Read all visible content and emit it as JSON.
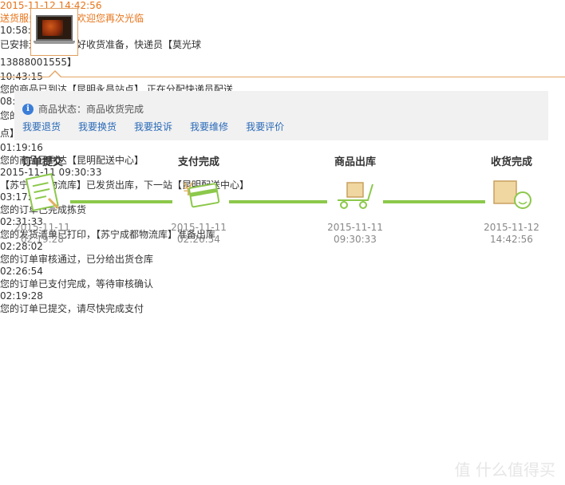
{
  "status": {
    "label": "商品状态：商品收货完成",
    "actions": [
      "我要退货",
      "我要换货",
      "我要投诉",
      "我要维修",
      "我要评价"
    ]
  },
  "steps": [
    {
      "title": "订单提交",
      "date": "2015-11-11",
      "time": "02:19:28"
    },
    {
      "title": "支付完成",
      "date": "2015-11-11",
      "time": "02:26:54"
    },
    {
      "title": "商品出库",
      "date": "2015-11-11",
      "time": "09:30:33"
    },
    {
      "title": "收货完成",
      "date": "2015-11-12",
      "time": "14:42:56"
    }
  ],
  "log": [
    {
      "time": "2015-11-12 14:42:56",
      "msg": "送货服务已完成，欢迎您再次光临",
      "highlight": true
    },
    {
      "time": "10:58:51",
      "msg": "已安排送货，请做好收货准备，快递员【莫光球 13888001555】"
    },
    {
      "time": "10:43:15",
      "msg": "您的商品已到达【昆明永昌站点】,正在分配快递员配送"
    },
    {
      "time": "08:57:43",
      "msg": "您的订单商品已出【昆明配送中心】，下一站【昆明永昌站点】"
    },
    {
      "time": "01:19:16",
      "msg": "您的商品已到达【昆明配送中心】"
    },
    {
      "time": "2015-11-11 09:30:33",
      "msg": "【苏宁成都物流库】已发货出库，下一站【昆明配送中心】"
    },
    {
      "time": "03:17:40",
      "msg": "您的订单已完成拣货"
    },
    {
      "time": "02:31:33",
      "msg": "您的发货清单已打印，【苏宁成都物流库】准备出库"
    },
    {
      "time": "02:28:02",
      "msg": "您的订单审核通过，已分给出货仓库"
    },
    {
      "time": "02:26:54",
      "msg": "您的订单已支付完成，等待审核确认"
    },
    {
      "time": "02:19:28",
      "msg": "您的订单已提交，请尽快完成支付"
    }
  ],
  "watermark": "值 什么值得买",
  "colors": {
    "accent": "#e8741a",
    "link": "#2a6ab8",
    "progress": "#8cc84b",
    "border": "#e4a566"
  }
}
